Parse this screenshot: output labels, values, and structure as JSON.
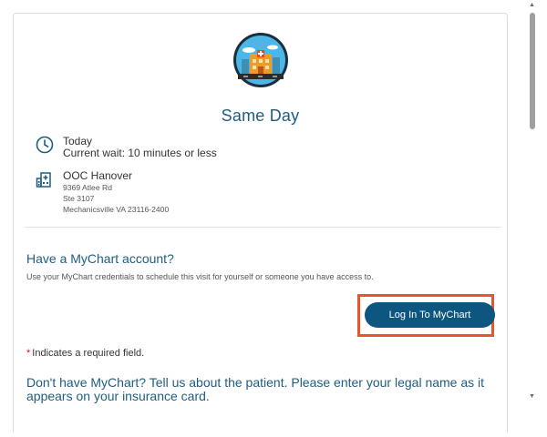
{
  "visit": {
    "title": "Same Day",
    "icon": "hospital-building-icon",
    "time_label": "Today",
    "wait_label": "Current wait: 10 minutes or less"
  },
  "location": {
    "icon": "hospital-location-icon",
    "name": "OOC Hanover",
    "address_line1": "9369 Atlee Rd",
    "address_line2": "Ste 3107",
    "address_line3": "Mechanicsville VA 23116-2400"
  },
  "mychart": {
    "heading": "Have a MyChart account?",
    "description": "Use your MyChart credentials to schedule this visit for yourself or someone you have access to.",
    "login_label": "Log In To MyChart",
    "highlight_color": "#e8542f",
    "button_color": "#0d5680"
  },
  "form": {
    "required_star": "*",
    "required_note": "Indicates a required field.",
    "patient_heading": "Don't have MyChart? Tell us about the patient. Please enter your legal name as it appears on your insurance card."
  },
  "colors": {
    "accent": "#1f5d80"
  }
}
